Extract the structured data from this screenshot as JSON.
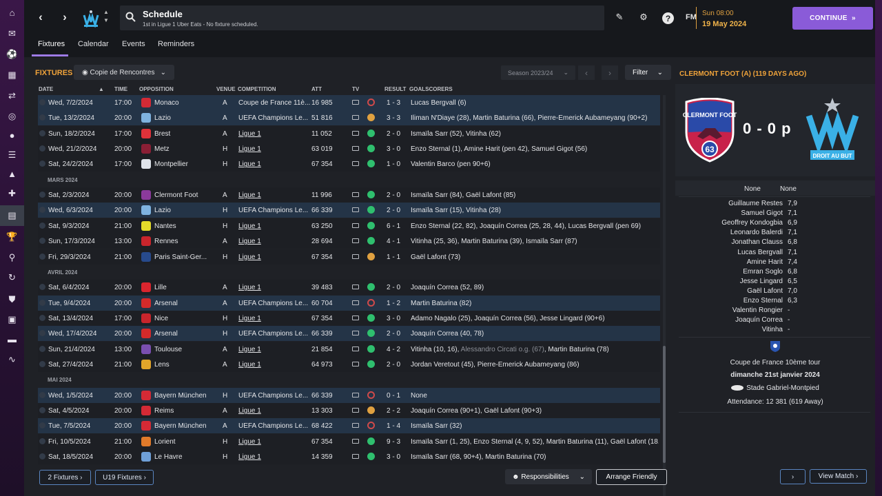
{
  "header": {
    "title": "Schedule",
    "subtitle": "1st in Ligue 1 Uber Eats - No fixture scheduled.",
    "fm_logo": "FM",
    "date_time": "Sun 08:00",
    "date": "19 May 2024",
    "continue_label": "CONTINUE"
  },
  "tabs": [
    {
      "label": "Fixtures"
    },
    {
      "label": "Calendar"
    },
    {
      "label": "Events"
    },
    {
      "label": "Reminders"
    }
  ],
  "fixtures": {
    "heading": "FIXTURES",
    "view_selector": "Copie de Rencontres",
    "season": "Season 2023/24",
    "filter_label": "Filter",
    "columns": [
      "DATE",
      "TIME",
      "OPPOSITION",
      "VENUE",
      "COMPETITION",
      "ATT",
      "TV",
      "RESULT",
      "GOALSCORERS"
    ],
    "rows": [
      {
        "type": "fixture",
        "hl": true,
        "date": "Wed, 7/2/2024",
        "time": "17:00",
        "opp": "Monaco",
        "crest": "#d42a35",
        "venue": "A",
        "comp": "Coupe de France 11è...",
        "att": "16 985",
        "res": "l",
        "score": "1 - 3",
        "scorers": "Lucas Bergvall (6)"
      },
      {
        "type": "fixture",
        "hl": true,
        "date": "Tue, 13/2/2024",
        "time": "20:00",
        "opp": "Lazio",
        "crest": "#7fb3e0",
        "venue": "A",
        "comp": "UEFA Champions Le...",
        "att": "51 816",
        "res": "d",
        "score": "3 - 3",
        "scorers": "Iliman N'Diaye (28), Martin Baturina (66), Pierre-Emerick Aubameyang (90+2)"
      },
      {
        "type": "fixture",
        "hl": false,
        "date": "Sun, 18/2/2024",
        "time": "17:00",
        "opp": "Brest",
        "crest": "#e0323a",
        "venue": "A",
        "comp": "Ligue 1",
        "att": "11 052",
        "res": "w",
        "score": "2 - 0",
        "scorers": "Ismaïla Sarr (52), Vitinha (62)"
      },
      {
        "type": "fixture",
        "hl": false,
        "date": "Wed, 21/2/2024",
        "time": "20:00",
        "opp": "Metz",
        "crest": "#8a1f35",
        "venue": "H",
        "comp": "Ligue 1",
        "att": "63 019",
        "res": "w",
        "score": "3 - 0",
        "scorers": "Enzo Sternal (1), Amine Harit (pen 42), Samuel Gigot (56)"
      },
      {
        "type": "fixture",
        "hl": false,
        "date": "Sat, 24/2/2024",
        "time": "17:00",
        "opp": "Montpellier",
        "crest": "#dfe3ea",
        "venue": "H",
        "comp": "Ligue 1",
        "att": "67 354",
        "res": "w",
        "score": "1 - 0",
        "scorers": "Valentin Barco (pen 90+6)"
      },
      {
        "type": "month",
        "label": "MARS 2024"
      },
      {
        "type": "fixture",
        "hl": false,
        "date": "Sat, 2/3/2024",
        "time": "20:00",
        "opp": "Clermont Foot",
        "crest": "#8b3a9c",
        "venue": "A",
        "comp": "Ligue 1",
        "att": "11 996",
        "res": "w",
        "score": "2 - 0",
        "scorers": "Ismaïla Sarr (84), Gaël Lafont (85)"
      },
      {
        "type": "fixture",
        "hl": true,
        "date": "Wed, 6/3/2024",
        "time": "20:00",
        "opp": "Lazio",
        "crest": "#7fb3e0",
        "venue": "H",
        "comp": "UEFA Champions Le...",
        "att": "66 339",
        "res": "w",
        "score": "2 - 0",
        "scorers": "Ismaïla Sarr (15), Vitinha (28)"
      },
      {
        "type": "fixture",
        "hl": false,
        "date": "Sat, 9/3/2024",
        "time": "21:00",
        "opp": "Nantes",
        "crest": "#e5dc2a",
        "venue": "H",
        "comp": "Ligue 1",
        "att": "63 250",
        "res": "w",
        "score": "6 - 1",
        "scorers": "Enzo Sternal (22, 82), Joaquín Correa (25, 28, 44), Lucas Bergvall (pen 69)"
      },
      {
        "type": "fixture",
        "hl": false,
        "date": "Sun, 17/3/2024",
        "time": "13:00",
        "opp": "Rennes",
        "crest": "#c9252c",
        "venue": "A",
        "comp": "Ligue 1",
        "att": "28 694",
        "res": "w",
        "score": "4 - 1",
        "scorers": "Vitinha (25, 36), Martin Baturina (39), Ismaïla Sarr (87)"
      },
      {
        "type": "fixture",
        "hl": false,
        "date": "Fri, 29/3/2024",
        "time": "21:00",
        "opp": "Paris Saint-Ger...",
        "crest": "#274a8c",
        "venue": "H",
        "comp": "Ligue 1",
        "att": "67 354",
        "res": "d",
        "score": "1 - 1",
        "scorers": "Gaël Lafont (73)"
      },
      {
        "type": "month",
        "label": "AVRIL 2024"
      },
      {
        "type": "fixture",
        "hl": false,
        "date": "Sat, 6/4/2024",
        "time": "20:00",
        "opp": "Lille",
        "crest": "#d9252e",
        "venue": "A",
        "comp": "Ligue 1",
        "att": "39 483",
        "res": "w",
        "score": "2 - 0",
        "scorers": "Joaquín Correa (52, 89)"
      },
      {
        "type": "fixture",
        "hl": true,
        "date": "Tue, 9/4/2024",
        "time": "20:00",
        "opp": "Arsenal",
        "crest": "#d42a2a",
        "venue": "A",
        "comp": "UEFA Champions Le...",
        "att": "60 704",
        "res": "l",
        "score": "1 - 2",
        "scorers": "Martin Baturina (82)"
      },
      {
        "type": "fixture",
        "hl": false,
        "date": "Sat, 13/4/2024",
        "time": "17:00",
        "opp": "Nice",
        "crest": "#c9252c",
        "venue": "H",
        "comp": "Ligue 1",
        "att": "67 354",
        "res": "w",
        "score": "3 - 0",
        "scorers": "Adamo Nagalo (25), Joaquín Correa (56), Jesse Lingard (90+6)"
      },
      {
        "type": "fixture",
        "hl": true,
        "date": "Wed, 17/4/2024",
        "time": "20:00",
        "opp": "Arsenal",
        "crest": "#d42a2a",
        "venue": "H",
        "comp": "UEFA Champions Le...",
        "att": "66 339",
        "res": "w",
        "score": "2 - 0",
        "scorers": "Joaquín Correa (40, 78)"
      },
      {
        "type": "fixture",
        "hl": false,
        "date": "Sun, 21/4/2024",
        "time": "13:00",
        "opp": "Toulouse",
        "crest": "#7a4fb0",
        "venue": "A",
        "comp": "Ligue 1",
        "att": "21 854",
        "res": "w",
        "score": "4 - 2",
        "scorers": "Vitinha (10, 16), ",
        "og": "Alessandro Circati o.g. (67)",
        "scorers2": ", Martin Baturina (78)"
      },
      {
        "type": "fixture",
        "hl": false,
        "date": "Sat, 27/4/2024",
        "time": "21:00",
        "opp": "Lens",
        "crest": "#e2a52a",
        "venue": "A",
        "comp": "Ligue 1",
        "att": "64 973",
        "res": "w",
        "score": "2 - 0",
        "scorers": "Jordan Veretout (45), Pierre-Emerick Aubameyang (86)"
      },
      {
        "type": "month",
        "label": "MAI 2024"
      },
      {
        "type": "fixture",
        "hl": true,
        "date": "Wed, 1/5/2024",
        "time": "20:00",
        "opp": "Bayern München",
        "crest": "#d42a35",
        "venue": "H",
        "comp": "UEFA Champions Le...",
        "att": "66 339",
        "res": "l",
        "score": "0 - 1",
        "scorers": "None"
      },
      {
        "type": "fixture",
        "hl": false,
        "date": "Sat, 4/5/2024",
        "time": "20:00",
        "opp": "Reims",
        "crest": "#d42a35",
        "venue": "A",
        "comp": "Ligue 1",
        "att": "13 303",
        "res": "d",
        "score": "2 - 2",
        "scorers": "Joaquín Correa (90+1), Gaël Lafont (90+3)"
      },
      {
        "type": "fixture",
        "hl": true,
        "date": "Tue, 7/5/2024",
        "time": "20:00",
        "opp": "Bayern München",
        "crest": "#d42a35",
        "venue": "A",
        "comp": "UEFA Champions Le...",
        "att": "68 422",
        "res": "l",
        "score": "1 - 4",
        "scorers": "Ismaïla Sarr (32)"
      },
      {
        "type": "fixture",
        "hl": false,
        "date": "Fri, 10/5/2024",
        "time": "21:00",
        "opp": "Lorient",
        "crest": "#e07a2a",
        "venue": "H",
        "comp": "Ligue 1",
        "att": "67 354",
        "res": "w",
        "score": "9 - 3",
        "scorers": "Ismaïla Sarr (1, 25), Enzo Sternal (4, 9, 52), Martin Baturina (11), Gaël Lafont (18..."
      },
      {
        "type": "fixture",
        "hl": false,
        "date": "Sat, 18/5/2024",
        "time": "20:00",
        "opp": "Le Havre",
        "crest": "#6fa0d8",
        "venue": "H",
        "comp": "Ligue 1",
        "att": "14 359",
        "res": "w",
        "score": "3 - 0",
        "scorers": "Ismaïla Sarr (68, 90+4), Martin Baturina (70)"
      }
    ]
  },
  "bottom": {
    "btn1": "2 Fixtures",
    "btn2": "U19 Fixtures",
    "responsibilities": "Responsibilities",
    "arrange": "Arrange Friendly"
  },
  "match": {
    "heading": "CLERMONT FOOT (A) (119 DAYS AGO)",
    "home_badge_text": "CLERMONT FOOT",
    "home_badge_num": "63",
    "score": "0 - 0 p",
    "away_badge_text": "DROIT AU BUT",
    "stat_left": "None",
    "stat_right": "None",
    "players": [
      {
        "name": "Guillaume Restes",
        "rating": "7,9"
      },
      {
        "name": "Samuel Gigot",
        "rating": "7,1"
      },
      {
        "name": "Geoffrey Kondogbia",
        "rating": "6,9"
      },
      {
        "name": "Leonardo Balerdi",
        "rating": "7,1"
      },
      {
        "name": "Jonathan Clauss",
        "rating": "6,8"
      },
      {
        "name": "Lucas Bergvall",
        "rating": "7,1"
      },
      {
        "name": "Amine Harit",
        "rating": "7,4"
      },
      {
        "name": "Emran Soglo",
        "rating": "6,8"
      },
      {
        "name": "Jesse Lingard",
        "rating": "6,5"
      },
      {
        "name": "Gaël Lafont",
        "rating": "7,0"
      },
      {
        "name": "Enzo Sternal",
        "rating": "6,3"
      },
      {
        "name": "Valentin Rongier",
        "rating": "-"
      },
      {
        "name": "Joaquín Correa",
        "rating": "-"
      },
      {
        "name": "Vitinha",
        "rating": "-"
      }
    ],
    "competition": "Coupe de France 10ème tour",
    "match_date": "dimanche 21st janvier 2024",
    "stadium": "Stade Gabriel-Montpied",
    "attendance": "Attendance: 12 381 (619 Away)",
    "view_match": "View Match"
  }
}
